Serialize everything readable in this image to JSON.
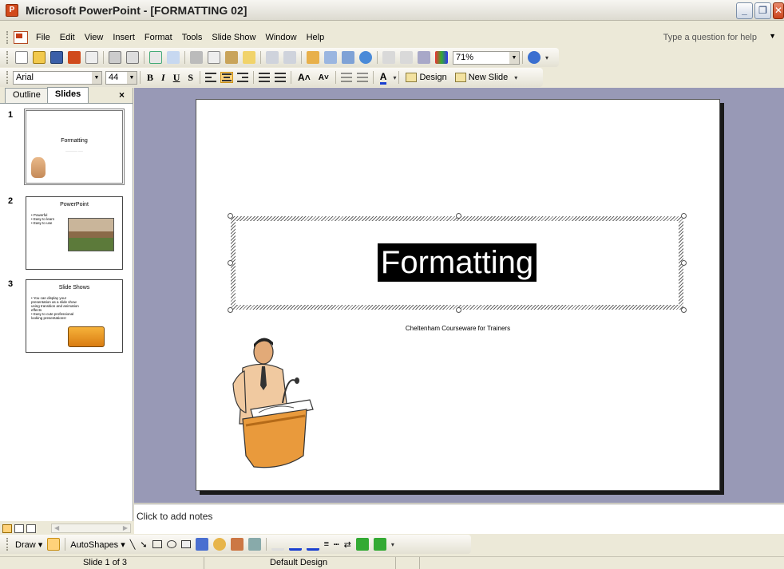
{
  "window": {
    "title": "Microsoft PowerPoint - [FORMATTING 02]",
    "app_icon": "powerpoint-icon",
    "controls": [
      "minimize-icon",
      "restore-icon",
      "close-icon"
    ]
  },
  "menu": {
    "items": [
      "File",
      "Edit",
      "View",
      "Insert",
      "Format",
      "Tools",
      "Slide Show",
      "Window",
      "Help"
    ],
    "help_placeholder": "Type a question for help"
  },
  "standard_toolbar": {
    "zoom": "71%"
  },
  "formatting_toolbar": {
    "font": "Arial",
    "size": "44",
    "bold": "B",
    "italic": "I",
    "underline": "U",
    "shadow": "S",
    "design_label": "Design",
    "new_slide_label": "New Slide"
  },
  "slides_pane": {
    "tabs": [
      "Outline",
      "Slides"
    ],
    "close": "×",
    "slides": [
      {
        "number": "1",
        "title": "Formatting",
        "subtitle": "————— ——"
      },
      {
        "number": "2",
        "title": "PowerPoint",
        "bullets": [
          "• Powerful",
          "• Easy to learn",
          "• Easy to use"
        ]
      },
      {
        "number": "3",
        "title": "Slide Shows",
        "bullets": [
          "• You can display your presentation as a slide show using transition and animation effects",
          "• Easy to cute professional looking presentations!"
        ]
      }
    ]
  },
  "slide": {
    "title": "Formatting",
    "subtitle": "Cheltenham Courseware for Trainers"
  },
  "notes": {
    "placeholder": "Click to add notes"
  },
  "draw_toolbar": {
    "draw": "Draw ▾",
    "autoshapes": "AutoShapes ▾"
  },
  "status": {
    "slide_position": "Slide 1 of 3",
    "design": "Default Design"
  },
  "colors": {
    "accent": "#ffd27a",
    "canvas": "#9899b6",
    "chrome": "#ece9d8"
  }
}
